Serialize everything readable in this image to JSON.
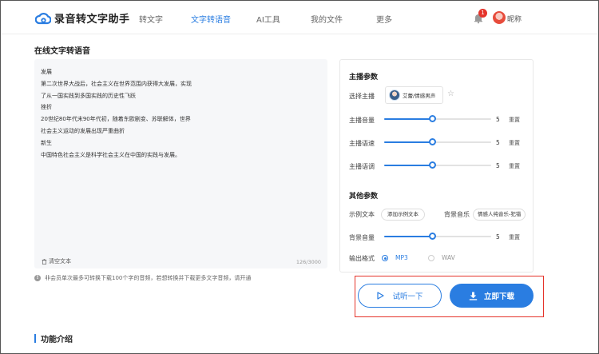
{
  "header": {
    "app_title": "录音转文字助手",
    "nav": [
      {
        "label": "转文字",
        "active": false
      },
      {
        "label": "文字转语音",
        "active": true
      },
      {
        "label": "AI工具",
        "active": false
      },
      {
        "label": "我的文件",
        "active": false
      },
      {
        "label": "更多",
        "active": false
      }
    ],
    "notification_count": "1",
    "username": "昵称"
  },
  "page_title": "在线文字转语音",
  "editor": {
    "lines": [
      "发展",
      "第二次世界大战后，社会主义在世界范围内获得大发展，实现",
      "了从一国实践到多国实践的历史性飞跃",
      "挫折",
      "20世纪80年代末90年代初，随着东欧剧变、苏联解体，世界",
      "社会主义运动的发展出现严重曲折",
      "新生",
      "中国特色社会主义是科学社会主义在中国的实践与发展。"
    ],
    "clear_label": "清空文本",
    "counter": "126/3000"
  },
  "notice": "非会员单次最多可转换下载100个字的音频，若想转换并下载更多文字音频，请开通",
  "panel": {
    "anchor_section_title": "主播参数",
    "anchor_label": "选择主播",
    "anchor_name": "艾蕾/情感男声",
    "sliders": [
      {
        "label": "主播音量",
        "value": "5",
        "level": 0.45,
        "reset": "重置"
      },
      {
        "label": "主播语速",
        "value": "5",
        "level": 0.45,
        "reset": "重置"
      },
      {
        "label": "主播语调",
        "value": "5",
        "level": 0.45,
        "reset": "重置"
      }
    ],
    "other_section_title": "其他参数",
    "sample_label": "示例文本",
    "sample_button": "添加示例文本",
    "bgm_label": "背景音乐",
    "bgm_value": "情感人纯音乐-犯错",
    "bg_volume": {
      "label": "背景音量",
      "value": "5",
      "level": 0.45,
      "reset": "重置"
    },
    "format_label": "输出格式",
    "formats": [
      {
        "label": "MP3",
        "checked": true
      },
      {
        "label": "WAV",
        "checked": false
      }
    ]
  },
  "actions": {
    "preview": "试听一下",
    "download": "立即下载"
  },
  "footer_title": "功能介绍",
  "colors": {
    "accent": "#2a7de1",
    "highlight_border": "#e5342b"
  },
  "icons": [
    "cloud-logo-icon",
    "bell-icon",
    "trash-icon",
    "info-icon",
    "star-icon",
    "play-icon",
    "download-icon"
  ]
}
